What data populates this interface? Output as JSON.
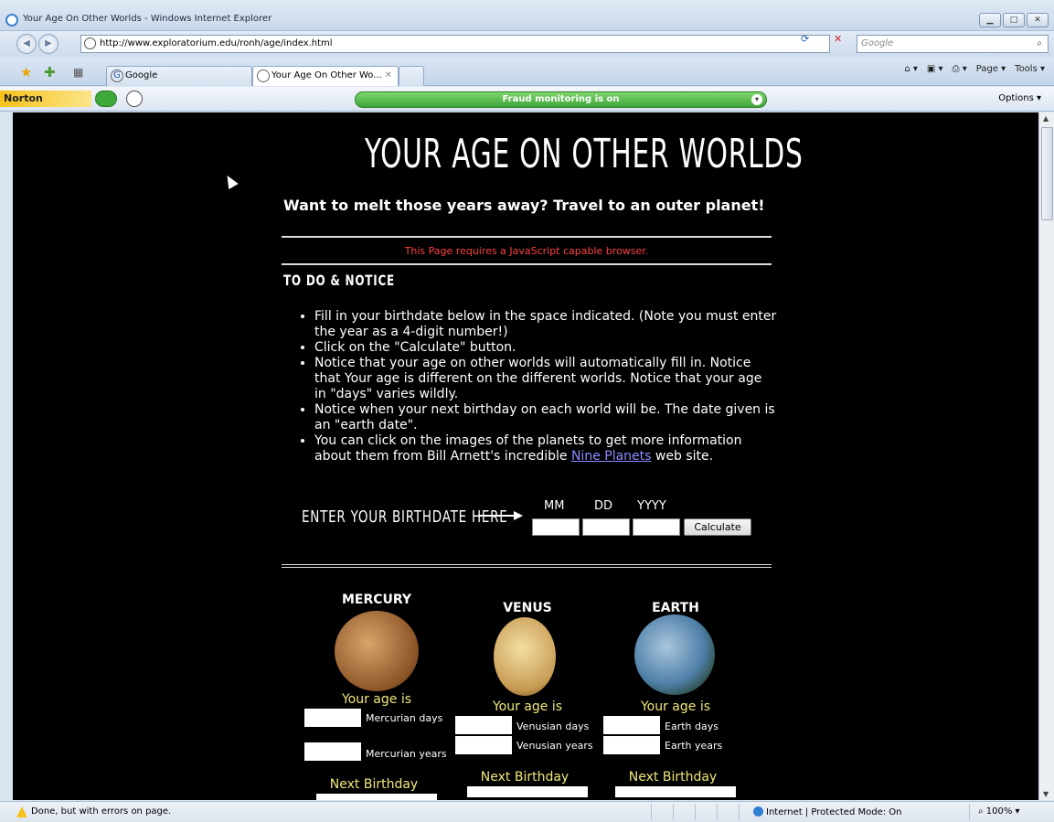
{
  "window": {
    "title": "Your Age On Other Worlds - Windows Internet Explorer"
  },
  "address": {
    "url": "http://www.exploratorium.edu/ronh/age/index.html",
    "search_placeholder": "Google"
  },
  "tabs": [
    {
      "label": "Google"
    },
    {
      "label": "Your Age On Other Wo..."
    }
  ],
  "commandbar": {
    "page": "Page ▾",
    "tools": "Tools ▾"
  },
  "norton": {
    "brand": "Norton",
    "fraud": "Fraud monitoring is on",
    "options": "Options ▾"
  },
  "page": {
    "title": "YOUR AGE ON OTHER WORLDS",
    "subtitle": "Want to melt those years away? Travel to an outer planet!",
    "js_message": "This Page requires a JavaScript capable browser.",
    "todo_heading": "TO DO & NOTICE",
    "list": [
      {
        "text": "Fill in your birthdate below in the space indicated. (Note you must enter the year as a 4-digit number!)"
      },
      {
        "text": "Click on the \"Calculate\" button."
      },
      {
        "text": "Notice that your age on other worlds will automatically fill in. Notice that Your age is different on the different worlds. Notice that your age in \"days\" varies wildly."
      },
      {
        "text": "Notice when your next birthday on each world will be. The date given is an \"earth date\"."
      },
      {
        "text_before": "You can click on the images of the planets to get more information about them from Bill Arnett's incredible ",
        "link": "Nine Planets",
        "text_after": " web site."
      }
    ],
    "birthdate_label": "ENTER YOUR BIRTHDATE HERE",
    "mm": "MM",
    "dd": "DD",
    "yyyy": "YYYY",
    "calculate": "Calculate",
    "planets": [
      {
        "name": "MERCURY",
        "age_is": "Your age is",
        "days": "Mercurian days",
        "years": "Mercurian years",
        "next": "Next Birthday",
        "color": "#b0763a"
      },
      {
        "name": "VENUS",
        "age_is": "Your age is",
        "days": "Venusian days",
        "years": "Venusian years",
        "next": "Next Birthday",
        "color": "#e3c27a"
      },
      {
        "name": "EARTH",
        "age_is": "Your age is",
        "days": "Earth days",
        "years": "Earth years",
        "next": "Next Birthday",
        "color": "#4f7fa8"
      }
    ]
  },
  "status": {
    "text": "Done, but with errors on page.",
    "zone": "Internet | Protected Mode: On",
    "zoom": "100%"
  }
}
